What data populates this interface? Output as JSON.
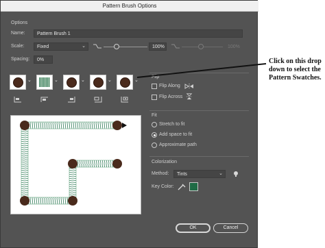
{
  "window": {
    "title": "Pattern Brush Options"
  },
  "options": {
    "group_label": "Options",
    "name_label": "Name:",
    "name_value": "Pattern Brush 1",
    "scale_label": "Scale:",
    "scale_value": "Fixed",
    "scale_percent": "100%",
    "scale_percent_max": "100%",
    "scale_slider_level": 0.3,
    "spacing_label": "Spacing:",
    "spacing_value": "0%"
  },
  "tiles": [
    {
      "kind": "dot"
    },
    {
      "kind": "chain"
    },
    {
      "kind": "dot"
    },
    {
      "kind": "dot"
    },
    {
      "kind": "dot"
    }
  ],
  "flip": {
    "group_label": "Flip",
    "flip_along_label": "Flip Along",
    "flip_across_label": "Flip Across",
    "flip_along_checked": false,
    "flip_across_checked": false
  },
  "fit": {
    "group_label": "Fit",
    "options": [
      "Stretch to fit",
      "Add space to fit",
      "Approximate path"
    ],
    "selected": 1
  },
  "colorization": {
    "group_label": "Colorization",
    "method_label": "Method:",
    "method_value": "Tints",
    "key_color_label": "Key Color:",
    "key_color": "#1f6b45"
  },
  "buttons": {
    "ok": "OK",
    "cancel": "Cancel"
  },
  "annotation": {
    "text": "Click on this drop down to select the Pattern Swatches."
  },
  "colors": {
    "dialog_bg": "#535353",
    "chain_green": "#2e7a56",
    "dot_brown": "#4a2a1c",
    "annotation_line": "#111111"
  }
}
